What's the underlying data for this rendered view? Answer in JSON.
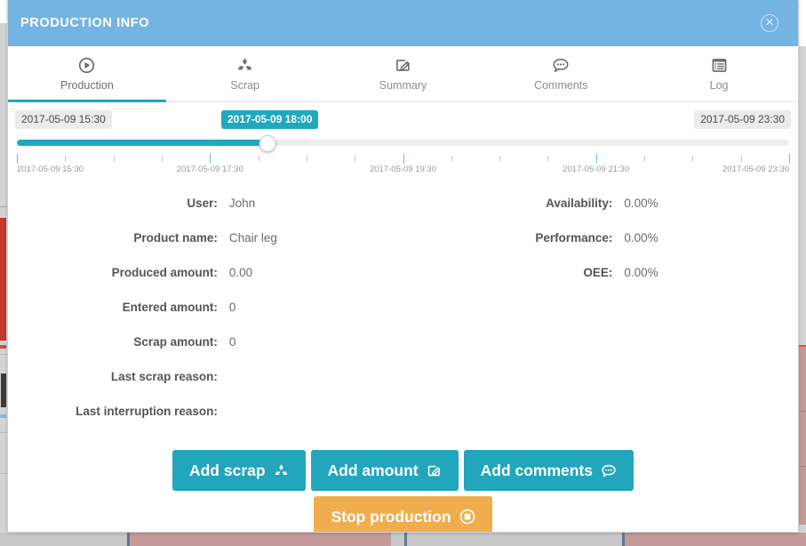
{
  "window": {
    "title": "PRODUCTION INFO",
    "close_icon": "close-circle-icon",
    "header_color": "#74b4e3",
    "accent_color": "#1fa8bf",
    "warn_color": "#f0ad4e"
  },
  "tabs": [
    {
      "label": "Production",
      "icon": "play-circle-icon",
      "active": true
    },
    {
      "label": "Scrap",
      "icon": "recycle-icon",
      "active": false
    },
    {
      "label": "Summary",
      "icon": "edit-square-icon",
      "active": false
    },
    {
      "label": "Comments",
      "icon": "comment-icon",
      "active": false
    },
    {
      "label": "Log",
      "icon": "list-window-icon",
      "active": false
    }
  ],
  "timeline": {
    "start_label": "2017-05-09 15:30",
    "current_label": "2017-05-09 18:00",
    "end_label": "2017-05-09 23:30",
    "fill_percent": 32.4,
    "axis_labels": [
      "2017-05-09 15:30",
      "2017-05-09 17:30",
      "2017-05-09 19:30",
      "2017-05-09 21:30",
      "2017-05-09 23:30"
    ]
  },
  "info": {
    "left": [
      {
        "label": "User:",
        "value": "John"
      },
      {
        "label": "Product name:",
        "value": "Chair leg"
      },
      {
        "label": "Produced amount:",
        "value": "0.00"
      },
      {
        "label": "Entered amount:",
        "value": "0"
      },
      {
        "label": "Scrap amount:",
        "value": "0"
      },
      {
        "label": "Last scrap reason:",
        "value": ""
      },
      {
        "label": "Last interruption reason:",
        "value": ""
      }
    ],
    "right": [
      {
        "label": "Availability:",
        "value": "0.00%"
      },
      {
        "label": "Performance:",
        "value": "0.00%"
      },
      {
        "label": "OEE:",
        "value": "0.00%"
      }
    ]
  },
  "actions": {
    "add_scrap": "Add scrap",
    "add_amount": "Add amount",
    "add_comments": "Add comments",
    "stop_production": "Stop production",
    "icons": {
      "add_scrap": "recycle-icon",
      "add_amount": "edit-square-icon",
      "add_comments": "comment-icon",
      "stop_production": "stop-circle-icon"
    }
  }
}
